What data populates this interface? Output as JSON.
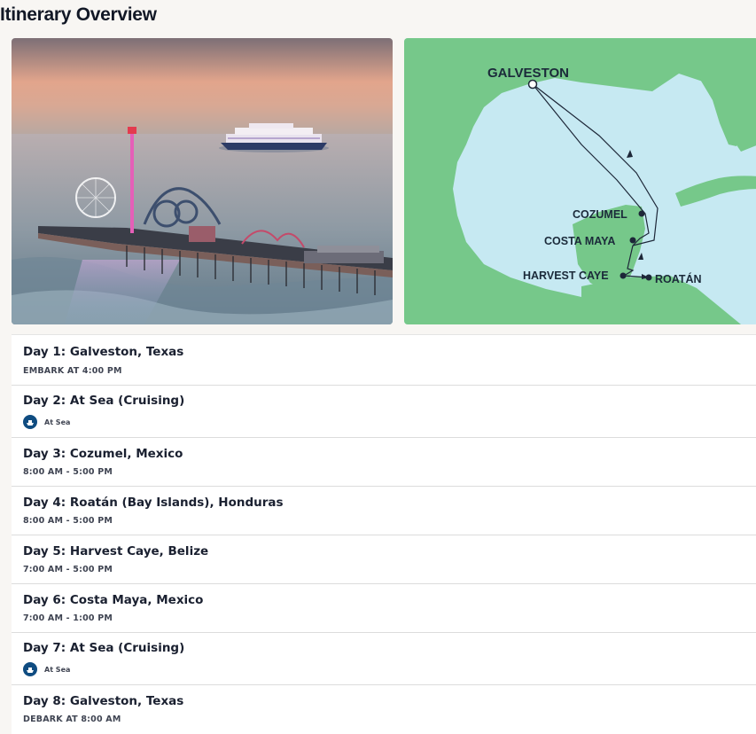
{
  "page": {
    "title": "Itinerary Overview"
  },
  "map": {
    "ports": [
      {
        "name": "GALVESTON"
      },
      {
        "name": "COZUMEL"
      },
      {
        "name": "COSTA MAYA"
      },
      {
        "name": "HARVEST CAYE"
      },
      {
        "name": "ROATÁN"
      }
    ]
  },
  "days": [
    {
      "title": "Day 1: Galveston, Texas",
      "sub": "EMBARK AT 4:00 PM"
    },
    {
      "title": "Day 2: At Sea (Cruising)",
      "sub": "At Sea",
      "icon": "ship-icon"
    },
    {
      "title": "Day 3: Cozumel, Mexico",
      "sub": "8:00 AM - 5:00 PM"
    },
    {
      "title": "Day 4: Roatán (Bay Islands), Honduras",
      "sub": "8:00 AM - 5:00 PM"
    },
    {
      "title": "Day 5: Harvest Caye, Belize",
      "sub": "7:00 AM - 5:00 PM"
    },
    {
      "title": "Day 6: Costa Maya, Mexico",
      "sub": "7:00 AM - 1:00 PM"
    },
    {
      "title": "Day 7: At Sea (Cruising)",
      "sub": "At Sea",
      "icon": "ship-icon"
    },
    {
      "title": "Day 8: Galveston, Texas",
      "sub": "DEBARK AT 8:00 AM"
    }
  ],
  "colors": {
    "sea_icon": "#0f4c81",
    "map_water": "#c6e9f2",
    "map_land": "#76c88a"
  }
}
